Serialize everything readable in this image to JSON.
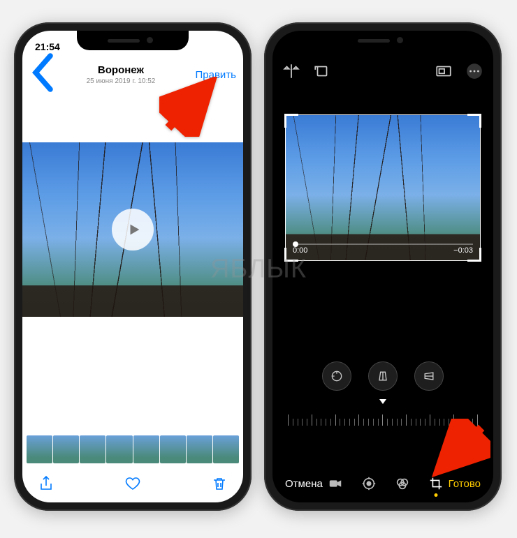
{
  "left": {
    "status_time": "21:54",
    "title": "Воронеж",
    "subtitle": "25 июня 2019 г.  10:52",
    "edit_label": "Править"
  },
  "right": {
    "time_current": "0:00",
    "time_remaining": "−0:03",
    "cancel_label": "Отмена",
    "done_label": "Готово"
  },
  "watermark": "ЯБЛЫК"
}
